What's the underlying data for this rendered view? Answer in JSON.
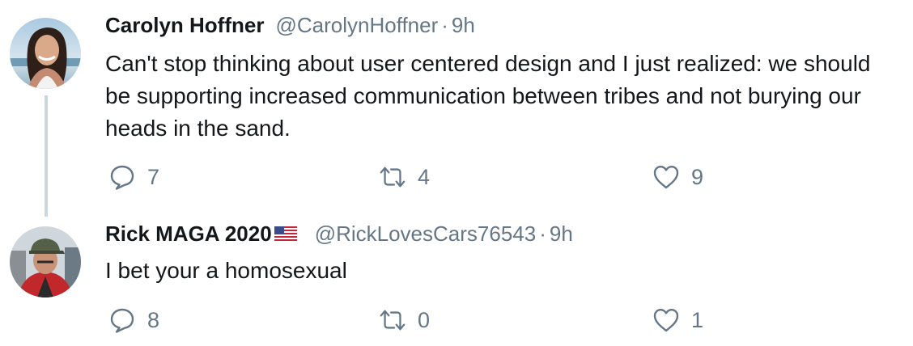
{
  "tweets": [
    {
      "author_name": "Carolyn Hoffner",
      "handle": "@CarolynHoffner",
      "separator": "·",
      "time": "9h",
      "text": "Can't stop thinking about user centered design and I just realized: we should be supporting increased communication between tribes and not burying our heads in the sand.",
      "reply_count": "7",
      "retweet_count": "4",
      "like_count": "9"
    },
    {
      "author_name": "Rick MAGA 2020",
      "flag": "us-flag-emoji",
      "handle": "@RickLovesCars76543",
      "separator": "·",
      "time": "9h",
      "text": "I bet your a homosexual",
      "reply_count": "8",
      "retweet_count": "0",
      "like_count": "1"
    }
  ],
  "icons": {
    "reply": "reply-icon",
    "retweet": "retweet-icon",
    "like": "like-icon"
  },
  "colors": {
    "text": "#14171a",
    "secondary": "#657786",
    "thread_line": "#ccd6dd"
  }
}
